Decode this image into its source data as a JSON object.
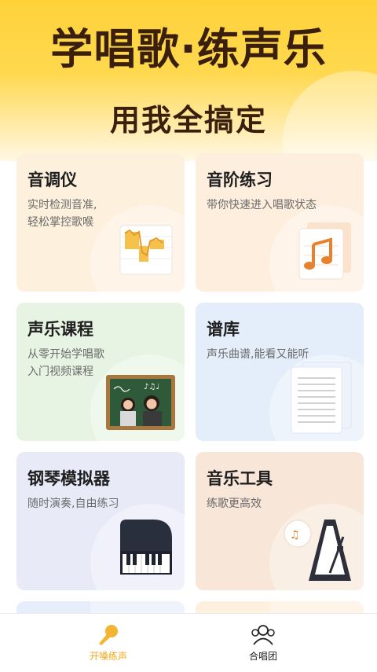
{
  "banner": {
    "title": "学唱歌·练声乐",
    "subtitle": "用我全搞定"
  },
  "cards": [
    {
      "title": "音调仪",
      "desc": "实时检测音准,\n轻松掌控歌喉",
      "icon": "pitch-meter-icon"
    },
    {
      "title": "音阶练习",
      "desc": "带你快速进入唱歌状态",
      "icon": "music-note-sheet-icon"
    },
    {
      "title": "声乐课程",
      "desc": "从零开始学唱歌\n入门视频课程",
      "icon": "chalkboard-video-icon"
    },
    {
      "title": "谱库",
      "desc": "声乐曲谱,能看又能听",
      "icon": "sheet-music-icon"
    },
    {
      "title": "钢琴模拟器",
      "desc": "随时演奏,自由练习",
      "icon": "piano-icon"
    },
    {
      "title": "音乐工具",
      "desc": "练歌更高效",
      "icon": "metronome-icon"
    }
  ],
  "tabbar": {
    "tabs": [
      {
        "label": "开嗓练声",
        "icon": "microphone-icon",
        "active": true
      },
      {
        "label": "合唱团",
        "icon": "group-icon",
        "active": false
      }
    ]
  },
  "colors": {
    "banner": "#ffd23a",
    "title_text": "#3a1f0c",
    "active_tab": "#f2a81d",
    "inactive_tab": "#222222"
  }
}
